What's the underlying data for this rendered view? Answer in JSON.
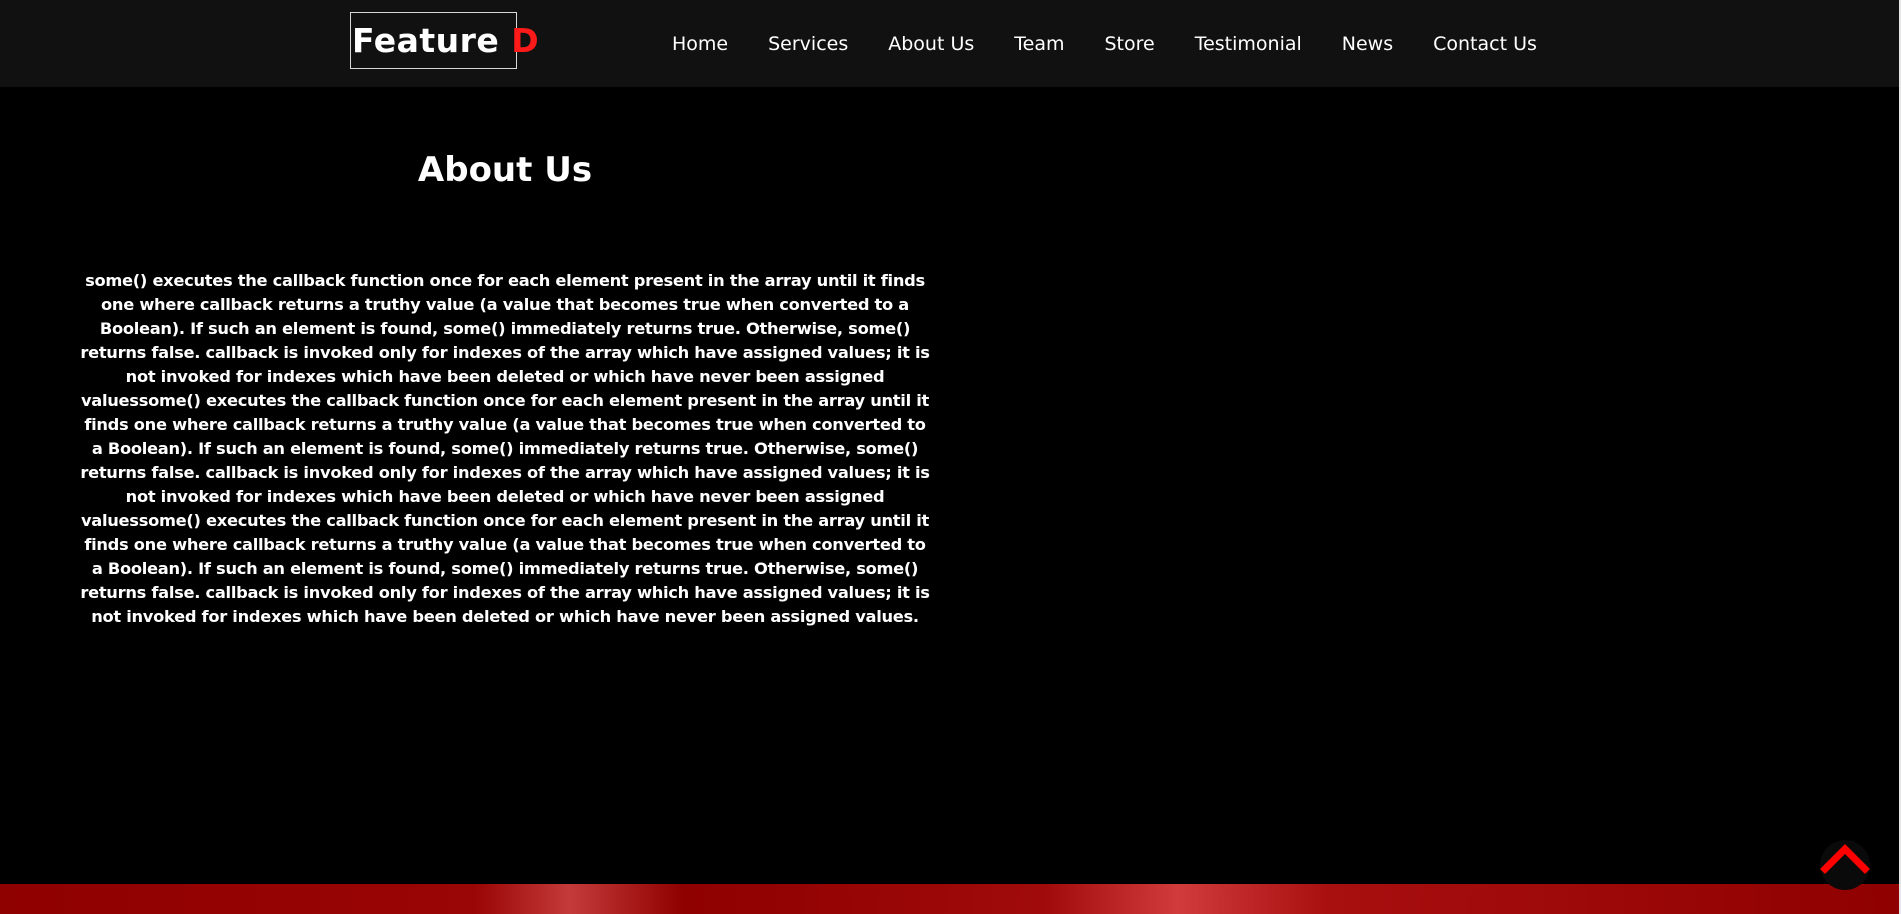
{
  "header": {
    "logo": {
      "text_main": "Feature ",
      "text_accent": "D",
      "accent_color": "#ff1a1a"
    },
    "nav": [
      {
        "label": "Home"
      },
      {
        "label": "Services"
      },
      {
        "label": "About Us"
      },
      {
        "label": "Team"
      },
      {
        "label": "Store"
      },
      {
        "label": "Testimonial"
      },
      {
        "label": "News"
      },
      {
        "label": "Contact Us"
      }
    ]
  },
  "about": {
    "title": "About Us",
    "body": "some() executes the callback function once for each element present in the array until it finds one where callback returns a truthy value (a value that becomes true when converted to a Boolean). If such an element is found, some() immediately returns true. Otherwise, some() returns false. callback is invoked only for indexes of the array which have assigned values; it is not invoked for indexes which have been deleted or which have never been assigned valuessome() executes the callback function once for each element present in the array until it finds one where callback returns a truthy value (a value that becomes true when converted to a Boolean). If such an element is found, some() immediately returns true. Otherwise, some() returns false. callback is invoked only for indexes of the array which have assigned values; it is not invoked for indexes which have been deleted or which have never been assigned valuessome() executes the callback function once for each element present in the array until it finds one where callback returns a truthy value (a value that becomes true when converted to a Boolean). If such an element is found, some() immediately returns true. Otherwise, some() returns false. callback is invoked only for indexes of the array which have assigned values; it is not invoked for indexes which have been deleted or which have never been assigned values."
  },
  "back_to_top": {
    "icon": "chevron-up-icon",
    "color": "#ff0000"
  },
  "colors": {
    "navbar_bg": "#111111",
    "page_bg": "#000000",
    "banner_red": "#8f0000"
  }
}
